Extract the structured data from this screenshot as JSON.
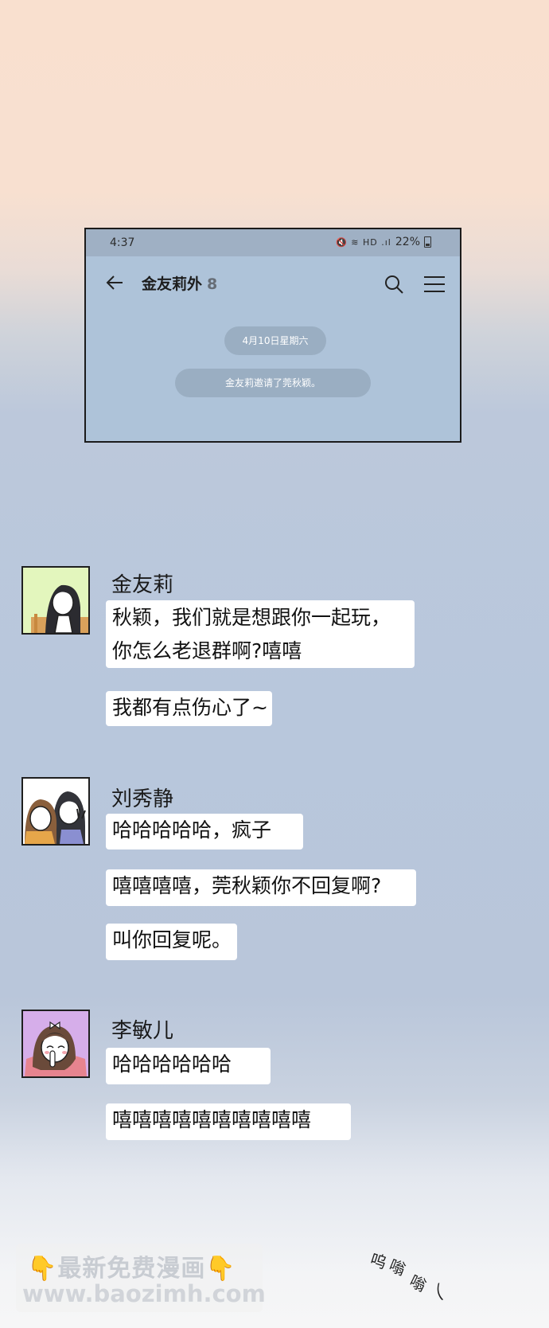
{
  "phone": {
    "status_time": "4:37",
    "status_icons": "🔇 ≋ HD .ıl",
    "battery": "22%",
    "chat_name": "金友莉外",
    "member_count": "8",
    "date_notice": "4月10日星期六",
    "invite_notice": "金友莉邀请了莞秋颖。"
  },
  "messages": [
    {
      "sender": "金友莉",
      "lines": [
        "秋颖，我们就是想跟你一起玩，",
        "你怎么老退群啊?嘻嘻"
      ],
      "followups": [
        "我都有点伤心了~"
      ]
    },
    {
      "sender": "刘秀静",
      "lines": [
        "哈哈哈哈哈，疯子"
      ],
      "followups": [
        "嘻嘻嘻嘻，莞秋颖你不回复啊?",
        "叫你回复呢。"
      ]
    },
    {
      "sender": "李敏儿",
      "lines": [
        "哈哈哈哈哈哈"
      ],
      "followups": [
        "嘻嘻嘻嘻嘻嘻嘻嘻嘻嘻"
      ]
    }
  ],
  "sfx": [
    "呜",
    "嗡",
    "嗡",
    "乀"
  ],
  "watermark": {
    "line1": "最新免费漫画",
    "line2": "www.baozimh.com",
    "hand": "👇"
  },
  "colors": {
    "phone_bg": "#aec3d9",
    "pill_bg": "#9aaec2",
    "bubble_bg": "#ffffff",
    "avatar1_bg": "#e3f6bd",
    "avatar2_bg": "#ffffff",
    "avatar3_bg": "#d6aeea"
  }
}
